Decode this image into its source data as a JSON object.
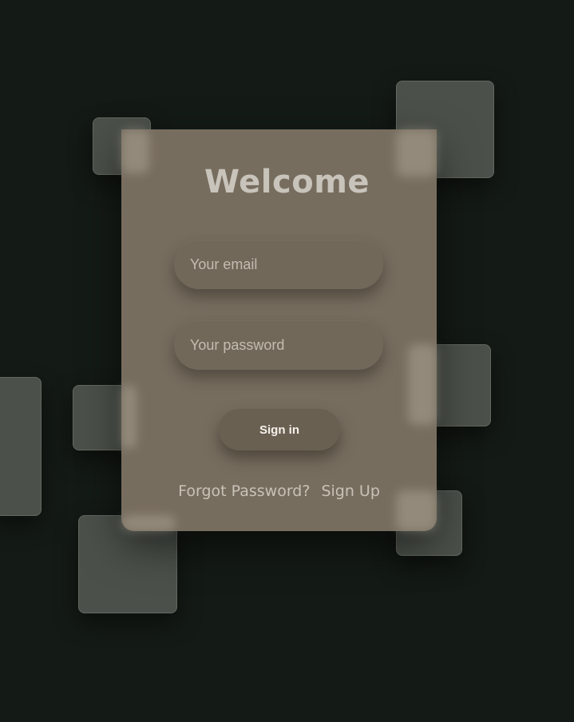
{
  "form": {
    "title": "Welcome",
    "email_placeholder": "Your email",
    "password_placeholder": "Your password",
    "signin_label": "Sign in",
    "forgot_label": "Forgot Password?",
    "signup_label": "Sign Up"
  },
  "colors": {
    "background": "#141a15",
    "card": "#776d5f",
    "square": "#4a5049",
    "title": "#c9c4bb"
  }
}
